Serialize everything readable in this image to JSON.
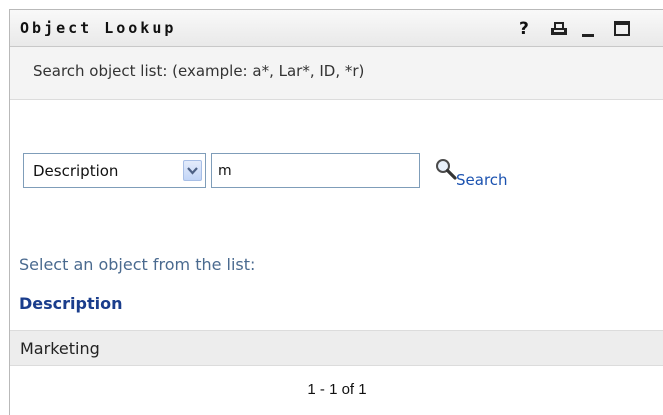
{
  "window": {
    "title": "Object Lookup",
    "icons": [
      "help-icon",
      "print-icon",
      "minimize-icon",
      "maximize-icon"
    ],
    "help_glyph": "?"
  },
  "hint": {
    "text": "Search object list: (example: a*, Lar*, ID, *r)"
  },
  "search": {
    "field_select": {
      "selected": "Description",
      "options": [
        "Description"
      ]
    },
    "query_value": "m",
    "button_label": "Search",
    "icon": "magnifier-icon"
  },
  "results": {
    "prompt": "Select an object from the list:",
    "column_header": "Description",
    "rows": [
      {
        "description": "Marketing"
      }
    ],
    "pagination": "1 - 1 of 1"
  },
  "colors": {
    "link": "#1b52b0",
    "header": "#1a3d8c",
    "prompt": "#4a6a8f",
    "row_bg": "#ededed"
  }
}
